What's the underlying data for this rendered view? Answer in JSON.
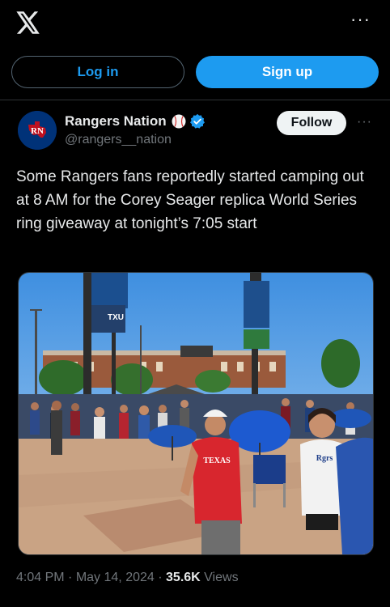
{
  "header": {
    "logo": "x-logo-icon",
    "menu_icon": "more-horizontal-icon",
    "menu_glyph": "···"
  },
  "auth": {
    "login_label": "Log in",
    "signup_label": "Sign up"
  },
  "post": {
    "author": {
      "display_name": "Rangers Nation",
      "handle": "@rangers__nation",
      "badges": [
        "baseball-emoji-icon",
        "verified-badge-icon"
      ],
      "avatar_text": "RN"
    },
    "follow_label": "Follow",
    "more_glyph": "···",
    "text": "Some Rangers fans reportedly started camping out at 8 AM for the Corey Seager replica World Series ring giveaway at tonight’s 7:05 start",
    "media": {
      "type": "photo",
      "signs": [
        "TXU energy",
        "TEXAS"
      ]
    },
    "time": "4:04 PM",
    "separator": "·",
    "date": "May 14, 2024",
    "views_count": "35.6K",
    "views_label": "Views"
  },
  "colors": {
    "accent": "#1d9bf0",
    "background": "#000000",
    "muted": "#71767b",
    "text": "#e7e9ea"
  }
}
